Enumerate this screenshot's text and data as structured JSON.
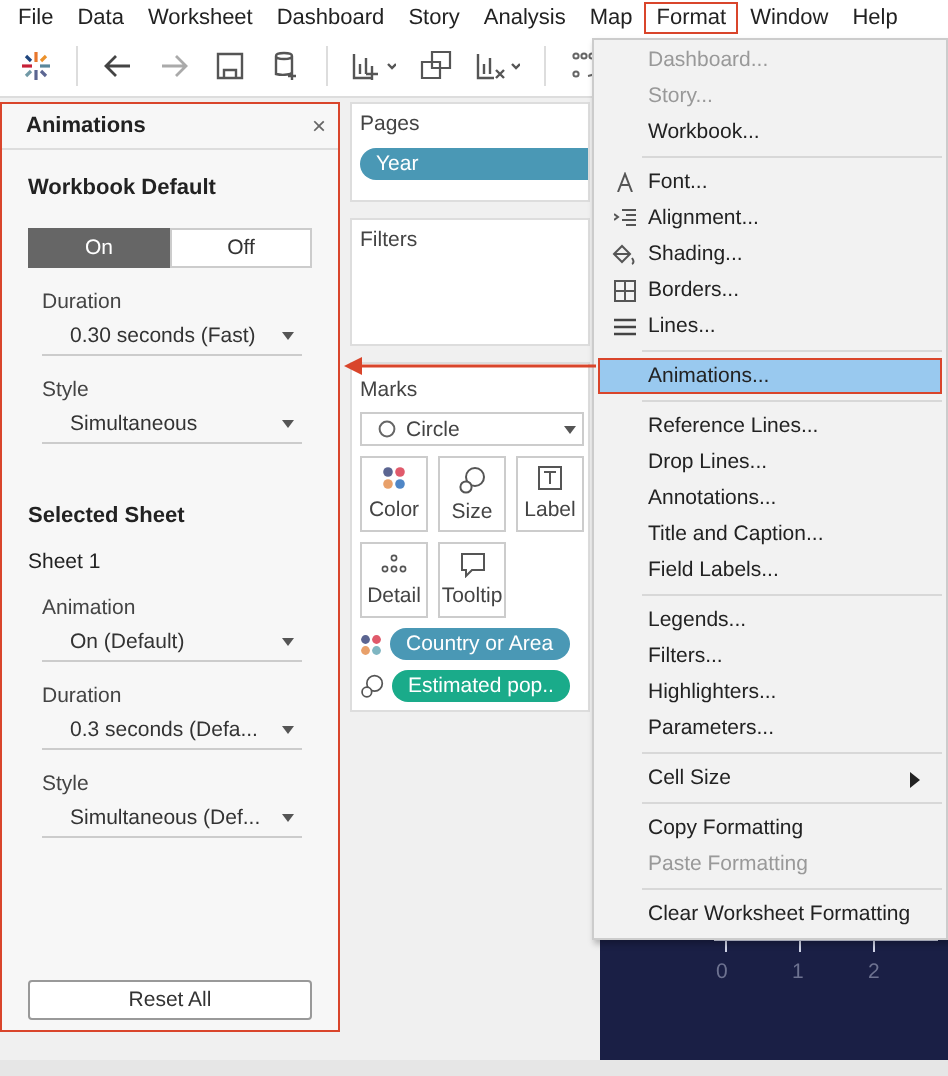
{
  "menubar": [
    {
      "label": "File",
      "selected": false
    },
    {
      "label": "Data",
      "selected": false
    },
    {
      "label": "Worksheet",
      "selected": false
    },
    {
      "label": "Dashboard",
      "selected": false
    },
    {
      "label": "Story",
      "selected": false
    },
    {
      "label": "Analysis",
      "selected": false
    },
    {
      "label": "Map",
      "selected": false
    },
    {
      "label": "Format",
      "selected": true
    },
    {
      "label": "Window",
      "selected": false
    },
    {
      "label": "Help",
      "selected": false
    }
  ],
  "animations_panel": {
    "title": "Animations",
    "close": "×",
    "highlighted": true,
    "workbook_default": {
      "heading": "Workbook Default",
      "toggle": [
        {
          "label": "On",
          "selected": true
        },
        {
          "label": "Off",
          "selected": false
        }
      ],
      "fields": [
        {
          "label": "Duration",
          "value": "0.30 seconds (Fast)"
        },
        {
          "label": "Style",
          "value": "Simultaneous"
        }
      ]
    },
    "selected_sheet": {
      "heading": "Selected Sheet",
      "sheet": "Sheet 1",
      "fields": [
        {
          "label": "Animation",
          "value": "On (Default)"
        },
        {
          "label": "Duration",
          "value": "0.3 seconds (Defa..."
        },
        {
          "label": "Style",
          "value": "Simultaneous (Def..."
        }
      ]
    },
    "reset": "Reset All"
  },
  "shelves": {
    "pages": {
      "title": "Pages",
      "pills": [
        {
          "label": "Year",
          "color": "#4a98b5"
        }
      ]
    },
    "filters": {
      "title": "Filters"
    },
    "marks": {
      "title": "Marks",
      "type": "Circle",
      "cards": [
        {
          "label": "Color",
          "kind": "color"
        },
        {
          "label": "Size",
          "kind": "size"
        },
        {
          "label": "Label",
          "kind": "label"
        },
        {
          "label": "Detail",
          "kind": "detail"
        },
        {
          "label": "Tooltip",
          "kind": "tooltip"
        }
      ],
      "fields": [
        {
          "label": "Country or Area",
          "kind": "color",
          "color": "#4a98b5"
        },
        {
          "label": "Estimated pop..",
          "kind": "size",
          "color": "#1aab8a"
        }
      ]
    }
  },
  "view": {
    "x_ticks": [
      "0",
      "1",
      "2"
    ]
  },
  "format_menu": {
    "callout_arrow": true,
    "items": [
      {
        "kind": "item",
        "label": "Dashboard...",
        "disabled": true,
        "selected": false
      },
      {
        "kind": "item",
        "label": "Story...",
        "disabled": true,
        "selected": false
      },
      {
        "kind": "item",
        "label": "Workbook...",
        "disabled": false,
        "selected": false
      },
      {
        "kind": "separator"
      },
      {
        "kind": "font",
        "label": "Font...",
        "disabled": false,
        "selected": false
      },
      {
        "kind": "alignment",
        "label": "Alignment...",
        "disabled": false,
        "selected": false
      },
      {
        "kind": "shading",
        "label": "Shading...",
        "disabled": false,
        "selected": false
      },
      {
        "kind": "borders",
        "label": "Borders...",
        "disabled": false,
        "selected": false
      },
      {
        "kind": "lines",
        "label": "Lines...",
        "disabled": false,
        "selected": false
      },
      {
        "kind": "separator"
      },
      {
        "kind": "item",
        "label": "Animations...",
        "disabled": false,
        "selected": true
      },
      {
        "kind": "separator"
      },
      {
        "kind": "item",
        "label": "Reference Lines...",
        "disabled": false,
        "selected": false
      },
      {
        "kind": "item",
        "label": "Drop Lines...",
        "disabled": false,
        "selected": false
      },
      {
        "kind": "item",
        "label": "Annotations...",
        "disabled": false,
        "selected": false
      },
      {
        "kind": "item",
        "label": "Title and Caption...",
        "disabled": false,
        "selected": false
      },
      {
        "kind": "item",
        "label": "Field Labels...",
        "disabled": false,
        "selected": false
      },
      {
        "kind": "separator"
      },
      {
        "kind": "item",
        "label": "Legends...",
        "disabled": false,
        "selected": false
      },
      {
        "kind": "item",
        "label": "Filters...",
        "disabled": false,
        "selected": false
      },
      {
        "kind": "item",
        "label": "Highlighters...",
        "disabled": false,
        "selected": false
      },
      {
        "kind": "item",
        "label": "Parameters...",
        "disabled": false,
        "selected": false
      },
      {
        "kind": "separator"
      },
      {
        "kind": "item",
        "label": "Cell Size",
        "disabled": false,
        "selected": false,
        "submenu": true
      },
      {
        "kind": "separator"
      },
      {
        "kind": "item",
        "label": "Copy Formatting",
        "disabled": false,
        "selected": false
      },
      {
        "kind": "item",
        "label": "Paste Formatting",
        "disabled": true,
        "selected": false
      },
      {
        "kind": "separator"
      },
      {
        "kind": "item",
        "label": "Clear Worksheet Formatting",
        "disabled": false,
        "selected": false
      }
    ]
  }
}
